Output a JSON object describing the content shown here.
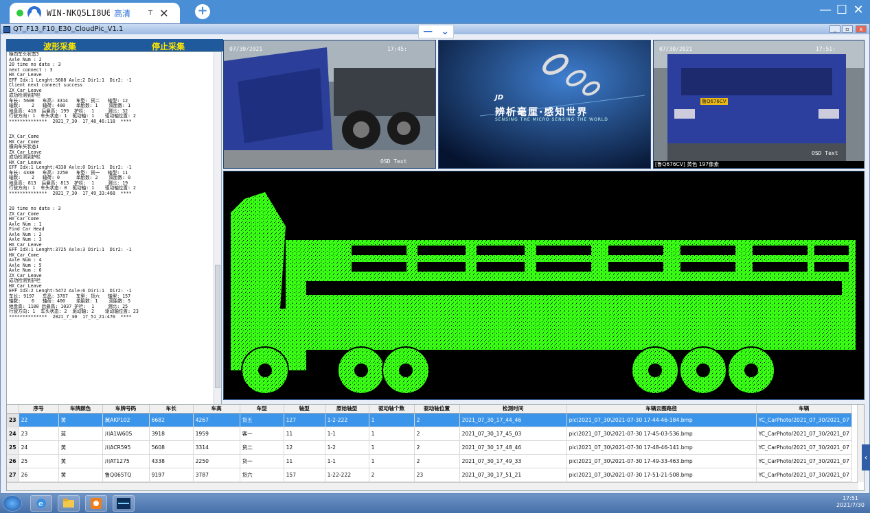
{
  "remote": {
    "host": "WIN-NKQ5LI8U6...",
    "quality": "高清",
    "tab_extra": "T"
  },
  "window": {
    "title": "QT_F13_F10_E30_CloudPic_V1.1"
  },
  "toolbar": {
    "start_label": "波形采集",
    "stop_label": "停止采集"
  },
  "log": {
    "text": "横向车头状态3\nAxle Num : 2\n20 time no data : 3\nnext connect : 3\nHX_Car_Leave\nEFF Idx:1 Lenght:5608 Axle:2 Dir1:1  Dir2: -1\nClient next connect success\nZX_Car_Leave\n成功检测到护栏\n车长: 5608   车高: 3314   车型: 货二   轴型: 12\n轴数:    2   轴荷: 400    单胎数: 1    双胎数: 1\n地盘高: 410  后悬高: 199  护栏:  1     测比: 32\n行驶方向: 1  车头状态: 1  驱动轴: 1    驱动轴位置: 2\n**************  2021_7_30  17_48_46:118  ****\n\n\nZX_Car_Come\nHX_Car_Come\n横向车头状态1\nZX_Car_Leave\n成功检测到护栏\nHX_Car_Leave\nEFF Idx:1 Lenght:4338 Axle:0 Dir1:1  Dir2: -1\n车长: 4338   车高: 2250   车型: 货一   轴型: 11\n轴数:    2   轴荷: 0      单胎数: 2    双胎数: 0\n地盘高: 813  后悬高: 813  护栏:  1     测比: 19\n行驶方向: 1  车头状态: 0  驱动轴: 1    驱动轴位置: 2\n**************  2021_7_30  17_49_33:468  ****\n\n\n20 time no data : 3\nZX_Car_Come\nHX_Car_Come\nAxle Num : 1\nFind Car Head\nAxle Num : 2\nAxle Num : 3\nHX_Car_Leave\nEFF Idx:1 Lenght:3725 Axle:3 Dir1:1  Dir2: -1\nHX_Car_Come\nAxle Num : 4\nAxle Num : 5\nAxle Num : 6\nZX_Car_Leave\n成功检测到护栏\nHX_Car_Leave\nEFF Idx:2 Lenght:5472 Axle:6 Dir1:1  Dir2: -1\n车长: 9197   车高: 3787   车型: 货六   轴型: 157\n轴数:    6   轴荷: 400    单胎数: 1    双胎数: 5\n地盘高: 1100 后悬高: 1037 护栏:  1     测比: 25\n行驶方向: 1  车头状态: 2  驱动轴: 2    驱动轴位置: 23\n**************  2021_7_30  17_51_21:470  ****"
  },
  "cameras": {
    "left": {
      "date": "07/30/2021",
      "time": "17:45:",
      "osd": "OSD Text"
    },
    "center": {
      "logo": "JD",
      "title": "辨析毫厘·感知世界",
      "subtitle": "SENSING THE MICRO SENSING THE WORLD"
    },
    "right": {
      "date": "07/30/2021",
      "time": "17:51:",
      "osd": "OSD Text",
      "plate_tag": "鲁Q676CV",
      "plate_info": "[鲁Q676CV] 黄色 197像素"
    }
  },
  "table": {
    "headers": [
      "",
      "序号",
      "车牌颜色",
      "车牌号码",
      "车长",
      "车高",
      "车型",
      "轴型",
      "原始轴型",
      "驱动轴个数",
      "驱动轴位置",
      "检测时间",
      "车辆云图路径",
      "车辆"
    ],
    "rows": [
      [
        "23",
        "22",
        "黄",
        "冀AKP102",
        "6682",
        "4267",
        "货五",
        "127",
        "1-2-222",
        "1",
        "2",
        "2021_07_30_17_44_46",
        "pic\\2021_07_30\\2021-07-30 17-44-46-184.bmp",
        "YC_CarPhoto/2021_07_30/2021_07"
      ],
      [
        "24",
        "23",
        "蓝",
        "川A1W60S",
        "3918",
        "1959",
        "客一",
        "11",
        "1-1",
        "1",
        "2",
        "2021_07_30_17_45_03",
        "pic\\2021_07_30\\2021-07-30 17-45-03-536.bmp",
        "YC_CarPhoto/2021_07_30/2021_07"
      ],
      [
        "25",
        "24",
        "黄",
        "川ACR595",
        "5608",
        "3314",
        "货二",
        "12",
        "1-2",
        "1",
        "2",
        "2021_07_30_17_48_46",
        "pic\\2021_07_30\\2021-07-30 17-48-46-141.bmp",
        "YC_CarPhoto/2021_07_30/2021_07"
      ],
      [
        "26",
        "25",
        "黄",
        "川AT1275",
        "4338",
        "2250",
        "货一",
        "11",
        "1-1",
        "1",
        "2",
        "2021_07_30_17_49_33",
        "pic\\2021_07_30\\2021-07-30 17-49-33-463.bmp",
        "YC_CarPhoto/2021_07_30/2021_07"
      ],
      [
        "27",
        "26",
        "黄",
        "鲁Q065TQ",
        "9197",
        "3787",
        "货六",
        "157",
        "1-22-222",
        "2",
        "23",
        "2021_07_30_17_51_21",
        "pic\\2021_07_30\\2021-07-30 17-51-21-508.bmp",
        "YC_CarPhoto/2021_07_30/2021_07"
      ]
    ],
    "selected_row": 0
  },
  "taskbar": {
    "time": "17:51",
    "date": "2021/7/30"
  },
  "colors": {
    "point_cloud": "#39ff14",
    "selection": "#3b95ea",
    "toolbar_text": "#ffe600"
  }
}
